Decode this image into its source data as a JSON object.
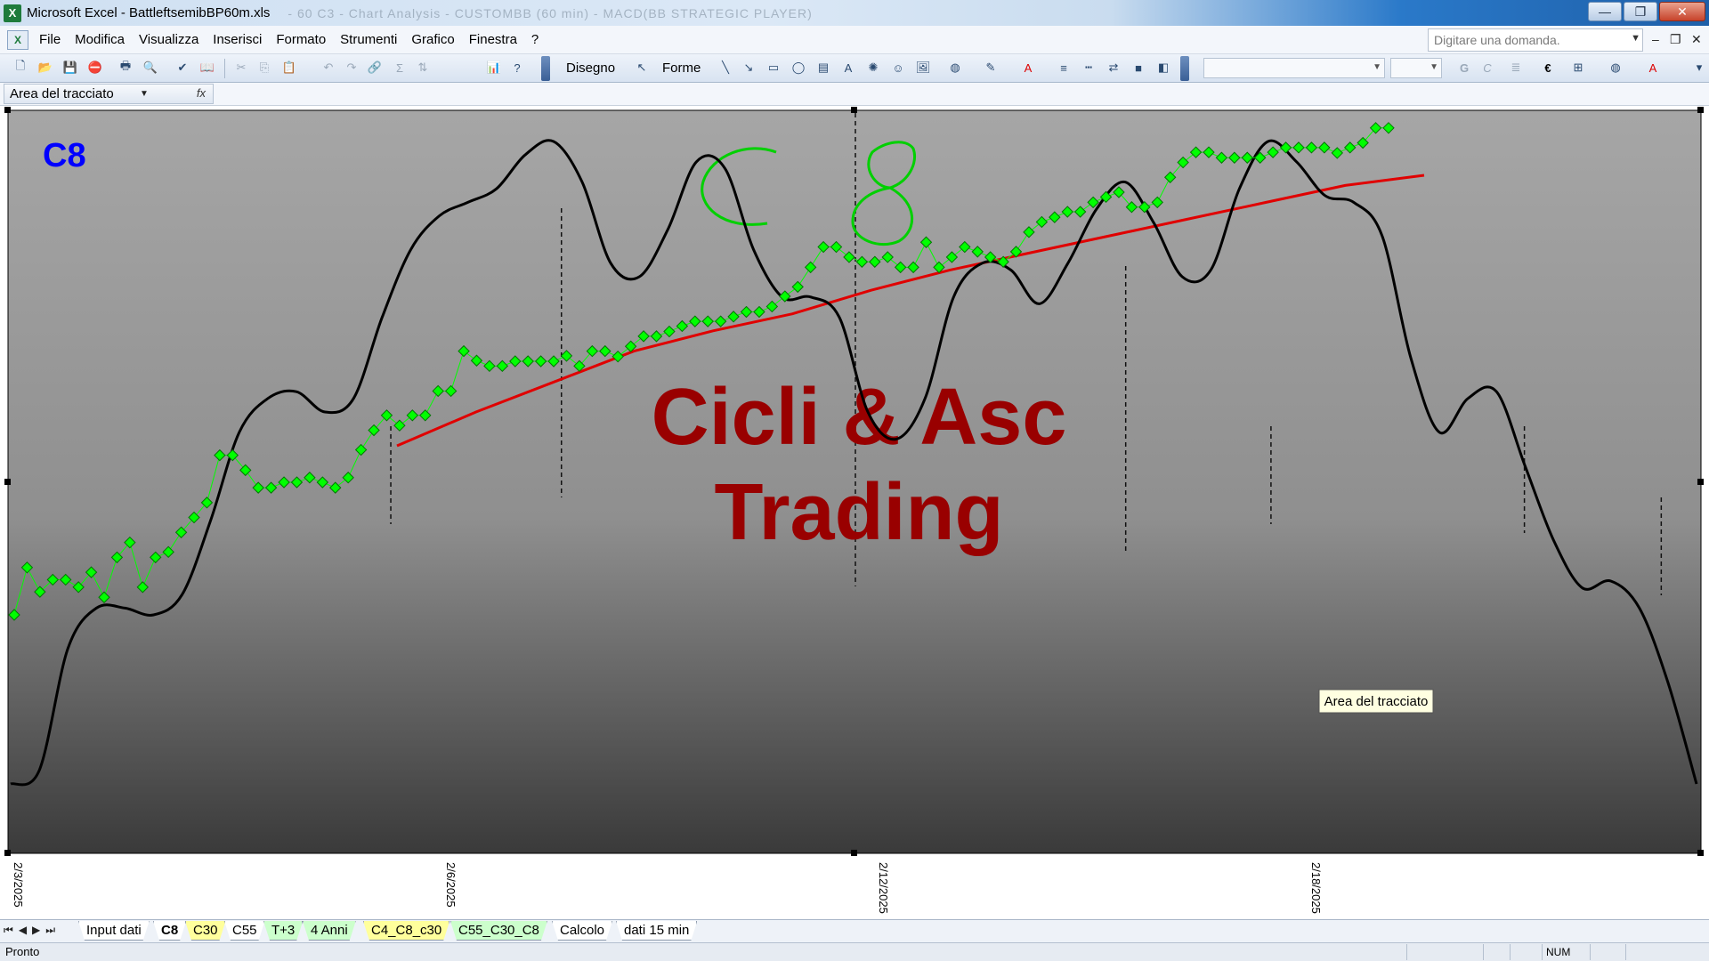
{
  "window": {
    "app_title": "Microsoft Excel - BattleftsemibBP60m.xls",
    "blurred_title_fragment": "- 60 C3 - Chart Analysis - CUSTOMBB (60 min) - MACD(BB STRATEGIC PLAYER)",
    "controls": {
      "minimize": "—",
      "restore": "❐",
      "close": "✕"
    }
  },
  "menu": {
    "items": [
      "File",
      "Modifica",
      "Visualizza",
      "Inserisci",
      "Formato",
      "Strumenti",
      "Grafico",
      "Finestra",
      "?"
    ],
    "question_placeholder": "Digitare una domanda."
  },
  "toolbar": {
    "draw_label": "Disegno",
    "shapes_label": "Forme",
    "bold_label": "G",
    "italic_label": "C",
    "euro_label": "€",
    "sigma_label": "Σ"
  },
  "namebox": {
    "value": "Area del tracciato"
  },
  "chart_data": {
    "type": "line",
    "title": "C8",
    "watermark": [
      "Cicli & Asc",
      "Trading"
    ],
    "handwritten_annotation": "C 8",
    "tooltip": "Area del tracciato",
    "x_tick_labels": [
      "2/3/2025",
      "2/6/2025",
      "2/12/2025",
      "2/18/2025"
    ],
    "series": [
      {
        "kind": "price-markers",
        "color": "#00ff00",
        "values": [
          0.3,
          0.37,
          0.334,
          0.352,
          0.352,
          0.341,
          0.363,
          0.326,
          0.385,
          0.407,
          0.341,
          0.385,
          0.393,
          0.422,
          0.444,
          0.466,
          0.536,
          0.536,
          0.514,
          0.488,
          0.488,
          0.496,
          0.496,
          0.503,
          0.496,
          0.488,
          0.503,
          0.544,
          0.573,
          0.595,
          0.58,
          0.595,
          0.595,
          0.631,
          0.631,
          0.69,
          0.676,
          0.668,
          0.668,
          0.675,
          0.675,
          0.675,
          0.675,
          0.683,
          0.668,
          0.69,
          0.69,
          0.682,
          0.697,
          0.712,
          0.712,
          0.719,
          0.727,
          0.734,
          0.734,
          0.734,
          0.741,
          0.748,
          0.748,
          0.756,
          0.771,
          0.785,
          0.814,
          0.844,
          0.844,
          0.829,
          0.822,
          0.822,
          0.829,
          0.814,
          0.814,
          0.851,
          0.814,
          0.829,
          0.844,
          0.837,
          0.829,
          0.822,
          0.837,
          0.866,
          0.881,
          0.888,
          0.896,
          0.896,
          0.91,
          0.918,
          0.925,
          0.903,
          0.903,
          0.91,
          0.947,
          0.969,
          0.984,
          0.984,
          0.976,
          0.976,
          0.976,
          0.976,
          0.984,
          0.991,
          0.991,
          0.991,
          0.991,
          0.983,
          0.991,
          0.998,
          1.02,
          1.02
        ]
      },
      {
        "kind": "trend-line",
        "color": "#e00000",
        "values": [
          0.55,
          0.6,
          0.645,
          0.69,
          0.72,
          0.745,
          0.78,
          0.81,
          0.835,
          0.86,
          0.885,
          0.91,
          0.935,
          0.95
        ]
      },
      {
        "kind": "cycle-oscillator",
        "color": "#000000",
        "values": [
          0.05,
          0.07,
          0.25,
          0.31,
          0.31,
          0.3,
          0.33,
          0.44,
          0.57,
          0.62,
          0.63,
          0.6,
          0.62,
          0.74,
          0.84,
          0.89,
          0.91,
          0.93,
          0.98,
          1.0,
          0.94,
          0.82,
          0.8,
          0.87,
          0.97,
          0.96,
          0.84,
          0.77,
          0.77,
          0.74,
          0.6,
          0.56,
          0.62,
          0.77,
          0.82,
          0.81,
          0.76,
          0.82,
          0.9,
          0.94,
          0.88,
          0.8,
          0.81,
          0.93,
          1.0,
          0.97,
          0.92,
          0.91,
          0.86,
          0.68,
          0.57,
          0.62,
          0.63,
          0.52,
          0.41,
          0.34,
          0.35,
          0.31,
          0.2,
          0.05
        ]
      }
    ],
    "cycle_markers": [
      0.225,
      0.326,
      0.5,
      0.66,
      0.746,
      0.896,
      0.977
    ],
    "colors": {
      "title": "#0000ff",
      "watermark": "#990000",
      "annotation": "#00d000"
    }
  },
  "sheets": {
    "tabs": [
      {
        "label": "Input dati",
        "style": "plain"
      },
      {
        "label": "C8",
        "style": "active"
      },
      {
        "label": "C30",
        "style": "yellow"
      },
      {
        "label": "C55",
        "style": "plain"
      },
      {
        "label": "T+3",
        "style": "green"
      },
      {
        "label": "4 Anni",
        "style": "green"
      },
      {
        "label": "C4_C8_c30",
        "style": "yellow"
      },
      {
        "label": "C55_C30_C8",
        "style": "green"
      },
      {
        "label": "Calcolo",
        "style": "plain"
      },
      {
        "label": "dati 15 min",
        "style": "plain"
      }
    ]
  },
  "status": {
    "left": "Pronto",
    "num": "NUM"
  }
}
